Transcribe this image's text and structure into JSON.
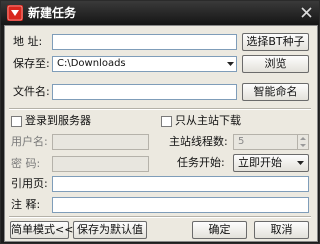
{
  "window": {
    "title": "新建任务",
    "icon": "thunder-logo-icon",
    "close_icon": "close-icon"
  },
  "address": {
    "label": "地  址:",
    "value": "",
    "torrent_button": "选择BT种子"
  },
  "save_to": {
    "label": "保存至:",
    "value": "C:\\Downloads",
    "browse_button": "浏览"
  },
  "filename": {
    "label": "文件名:",
    "value": "",
    "smart_name_button": "智能命名"
  },
  "login": {
    "checkbox_label": "登录到服务器",
    "checked": false,
    "username_label": "用户名:",
    "username_value": "",
    "password_label": "密  码:",
    "password_value": ""
  },
  "options": {
    "main_only_label": "只从主站下载",
    "main_only_checked": false,
    "threads_label": "主站线程数:",
    "threads_value": "5",
    "start_label": "任务开始:",
    "start_value": "立即开始"
  },
  "referer": {
    "label": "引用页:",
    "value": ""
  },
  "comment": {
    "label": "注  释:",
    "value": ""
  },
  "footer": {
    "simple_mode_button": "简单模式<<",
    "save_default_button": "保存为默认值",
    "ok_button": "确定",
    "cancel_button": "取消"
  },
  "colors": {
    "title_bar": "#1c1c1c",
    "dialog_bg": "#ece9e0",
    "accent": "#d8261d"
  }
}
